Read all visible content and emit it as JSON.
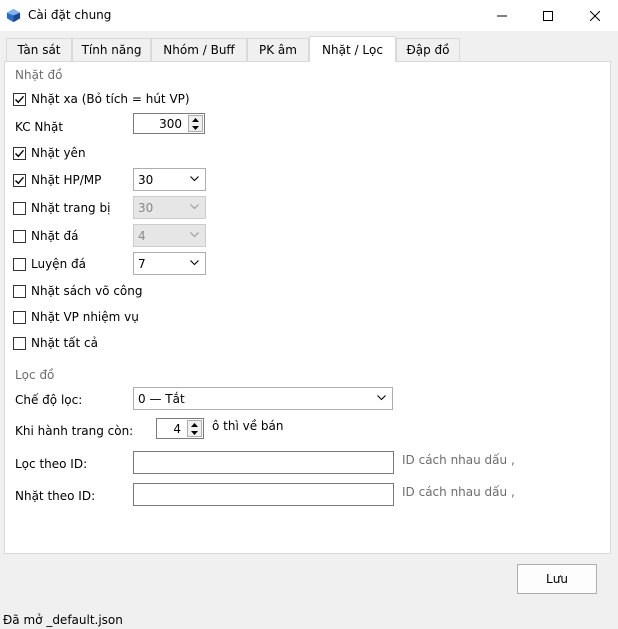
{
  "window": {
    "title": "Cài đặt chung",
    "icon": "app-gem-icon",
    "controls": [
      "minimize-icon",
      "maximize-icon",
      "close-icon"
    ]
  },
  "tabs": [
    {
      "label": "Tàn sát",
      "active": false
    },
    {
      "label": "Tính năng",
      "active": false
    },
    {
      "label": "Nhóm / Buff",
      "active": false
    },
    {
      "label": "PK âm",
      "active": false
    },
    {
      "label": "Nhặt / Lọc",
      "active": true
    },
    {
      "label": "Đập đồ",
      "active": false
    }
  ],
  "pickup": {
    "group_label": "Nhặt đồ",
    "far_pickup": {
      "label": "Nhặt xa (Bỏ tích = hút VP)",
      "checked": true
    },
    "distance": {
      "label": "KC Nhặt",
      "value": "300"
    },
    "pick_gold": {
      "label": "Nhặt yên",
      "checked": true
    },
    "pick_hpmp": {
      "label": "Nhặt HP/MP",
      "checked": true,
      "value": "30"
    },
    "pick_equip": {
      "label": "Nhặt trang bị",
      "checked": false,
      "value": "30"
    },
    "pick_stone": {
      "label": "Nhặt đá",
      "checked": false,
      "value": "4"
    },
    "refine_stone": {
      "label": "Luyện đá",
      "checked": false,
      "value": "7"
    },
    "pick_books": {
      "label": "Nhặt sách võ công",
      "checked": false
    },
    "pick_quest": {
      "label": "Nhặt VP nhiệm vụ",
      "checked": false
    },
    "pick_all": {
      "label": "Nhặt tất cả",
      "checked": false
    }
  },
  "filter": {
    "group_label": "Lọc đồ",
    "mode": {
      "label": "Chế độ lọc:",
      "value": "0 — Tắt"
    },
    "bag_slots": {
      "label": "Khi hành trang còn:",
      "value": "4",
      "suffix": "ô thì về bán"
    },
    "filter_id": {
      "label": "Lọc theo ID:",
      "value": "",
      "hint": "ID cách nhau dấu ,"
    },
    "pick_id": {
      "label": "Nhặt theo ID:",
      "value": "",
      "hint": "ID cách nhau dấu ,"
    }
  },
  "save_label": "Lưu",
  "status": "Đã mở _default.json"
}
